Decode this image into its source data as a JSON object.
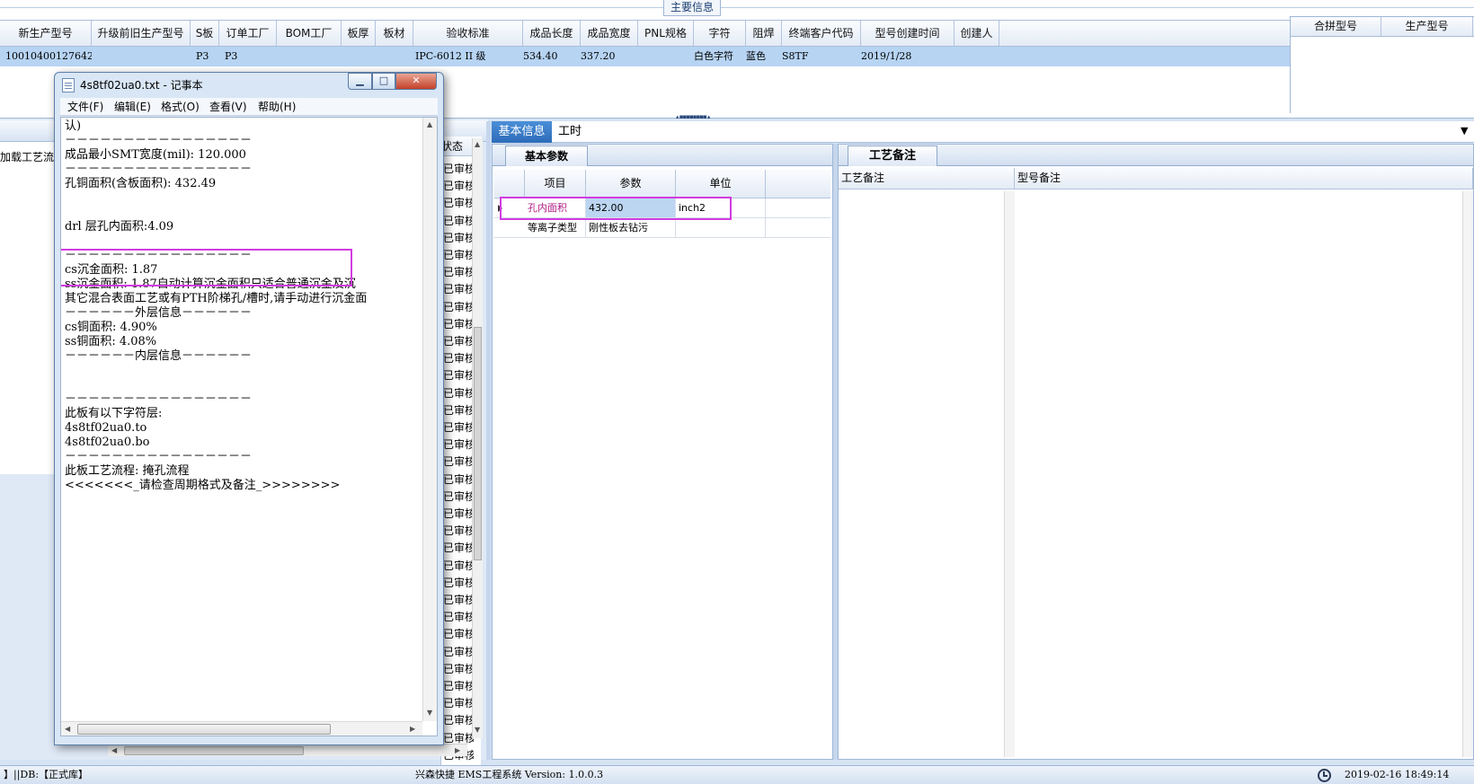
{
  "top_section": {
    "title": "主要信息",
    "columns": [
      "新生产型号",
      "升级前旧生产型号",
      "S板",
      "订单工厂",
      "BOM工厂",
      "板厚",
      "板材",
      "验收标准",
      "成品长度",
      "成品宽度",
      "PNL规格",
      "字符",
      "阻焊",
      "终端客户代码",
      "型号创建时间",
      "创建人"
    ],
    "row": [
      "10010400127642",
      "",
      "P3",
      "P3",
      "",
      "",
      "",
      "IPC-6012 II 级",
      "534.40",
      "337.20",
      "",
      "白色字符",
      "蓝色",
      "S8TF",
      "2019/1/28",
      ""
    ],
    "right_columns": [
      "合拼型号",
      "生产型号"
    ]
  },
  "left_panel": {
    "tab_label": "加载工艺流程",
    "status_header": "状态",
    "status_value": "已审核"
  },
  "notepad": {
    "title": "4s8tf02ua0.txt - 记事本",
    "window_buttons": {
      "minimize": "▁",
      "maximize": "□",
      "close": "✕"
    },
    "menu": [
      "文件(F)",
      "编辑(E)",
      "格式(O)",
      "查看(V)",
      "帮助(H)"
    ],
    "lines": [
      "认)",
      "－－－－－－－－－－－－－－－－",
      "成品最小SMT宽度(mil): 120.000",
      "－－－－－－－－－－－－－－－－",
      "孔铜面积(含板面积): 432.49",
      "",
      "",
      "drl           层孔内面积:4.09",
      "",
      "－－－－－－－－－－－－－－－－",
      "cs沉金面积: 1.87",
      "ss沉金面积: 1.87自动计算沉金面积只适合普通沉金及沉",
      "其它混合表面工艺或有PTH阶梯孔/槽时,请手动进行沉金面",
      "－－－－－－外层信息－－－－－－",
      "cs铜面积: 4.90%",
      "ss铜面积: 4.08%",
      "－－－－－－内层信息－－－－－－",
      "",
      "",
      "－－－－－－－－－－－－－－－－",
      "此板有以下字符层:",
      "4s8tf02ua0.to",
      "4s8tf02ua0.bo",
      "－－－－－－－－－－－－－－－－",
      "此板工艺流程: 掩孔流程",
      "<<<<<<<_请检查周期格式及备注_>>>>>>>>"
    ]
  },
  "middle": {
    "tabs": [
      "基本信息",
      "工时"
    ],
    "subtab": "基本参数",
    "columns": [
      "项目",
      "参数",
      "单位"
    ],
    "rows": [
      [
        "孔内面积",
        "432.00",
        "inch2"
      ],
      [
        "等离子类型",
        "刚性板去钻污",
        ""
      ]
    ]
  },
  "right": {
    "subtab": "工艺备注",
    "columns": [
      "工艺备注",
      "型号备注"
    ]
  },
  "status_bar": {
    "db": "】||DB:【正式库】",
    "app": "兴森快捷 EMS工程系统 Version: 1.0.0.3",
    "datetime": "2019-02-16 18:49:14"
  }
}
